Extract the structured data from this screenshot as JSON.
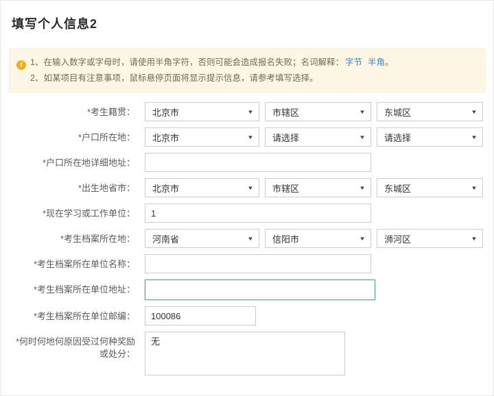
{
  "page": {
    "title": "填写个人信息2"
  },
  "icons": {
    "select_arrow": "▼",
    "info": "i"
  },
  "colors": {
    "notice_bg": "#fdf7e3",
    "notice_border": "#f2ecd2",
    "info_icon": "#f0ad1f",
    "link": "#3e83c9",
    "focus_border": "#5f9ea0",
    "input_border": "#cccccc"
  },
  "notice": {
    "line1_prefix": "1、在输入数字或字母时，请使用半角字符，否则可能会造成报名失败；名词解释：",
    "line1_link1": "字节",
    "line1_link2": "半角",
    "line1_suffix": "。",
    "line2": "2、如某项目有注意事项，鼠标悬停页面将显示提示信息，请参考填写选择。"
  },
  "form": {
    "rows": [
      {
        "label": "*考生籍贯：",
        "type": "selects",
        "values": [
          "北京市",
          "市辖区",
          "东城区"
        ]
      },
      {
        "label": "*户口所在地：",
        "type": "selects",
        "values": [
          "北京市",
          "请选择",
          "请选择"
        ]
      },
      {
        "label": "*户口所在地详细地址：",
        "type": "text",
        "value": ""
      },
      {
        "label": "*出生地省市：",
        "type": "selects",
        "values": [
          "北京市",
          "市辖区",
          "东城区"
        ]
      },
      {
        "label": "*现在学习或工作单位：",
        "type": "text",
        "value": "1"
      },
      {
        "label": "*考生档案所在地：",
        "type": "selects",
        "values": [
          "河南省",
          "信阳市",
          "浉河区"
        ]
      },
      {
        "label": "*考生档案所在单位名称：",
        "type": "text",
        "value": ""
      },
      {
        "label": "*考生档案所在单位地址：",
        "type": "text",
        "value": "",
        "focused": true
      },
      {
        "label": "*考生档案所在单位邮编：",
        "type": "text",
        "value": "100086",
        "short": true
      },
      {
        "label": "*何时何地何原因受过何种奖励或处分：",
        "type": "textarea",
        "value": "无"
      }
    ]
  }
}
